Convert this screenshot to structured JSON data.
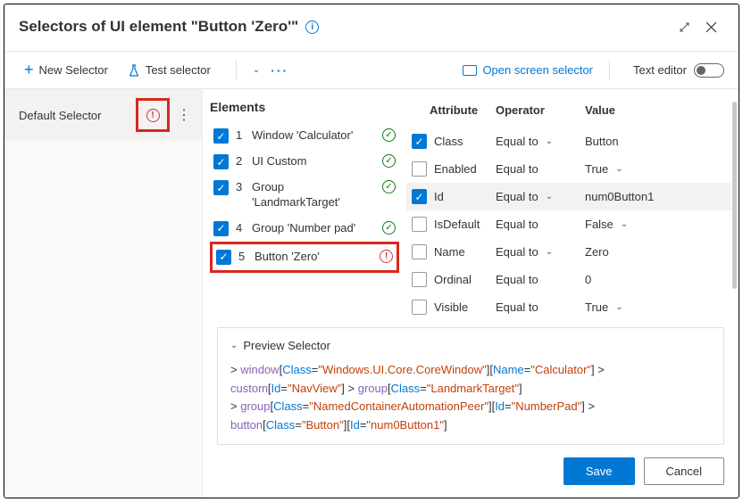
{
  "title": "Selectors of UI element \"Button 'Zero'\"",
  "toolbar": {
    "new_selector": "New Selector",
    "test_selector": "Test selector",
    "open_screen": "Open screen selector",
    "text_editor": "Text editor"
  },
  "sidebar": {
    "default_selector": "Default Selector"
  },
  "elements": {
    "heading": "Elements",
    "rows": [
      {
        "n": "1",
        "label": "Window 'Calculator'",
        "ok": true
      },
      {
        "n": "2",
        "label": "UI Custom",
        "ok": true
      },
      {
        "n": "3",
        "label": "Group 'LandmarkTarget'",
        "ok": true
      },
      {
        "n": "4",
        "label": "Group 'Number pad'",
        "ok": true
      },
      {
        "n": "5",
        "label": "Button 'Zero'",
        "ok": false
      }
    ]
  },
  "attr": {
    "h1": "Attribute",
    "h2": "Operator",
    "h3": "Value",
    "rows": [
      {
        "name": "Class",
        "op": "Equal to",
        "val": "Button",
        "cb": true,
        "chev_op": true,
        "chev_val": false,
        "sel": false
      },
      {
        "name": "Enabled",
        "op": "Equal to",
        "val": "True",
        "cb": false,
        "chev_op": false,
        "chev_val": true,
        "sel": false
      },
      {
        "name": "Id",
        "op": "Equal to",
        "val": "num0Button1",
        "cb": true,
        "chev_op": true,
        "chev_val": false,
        "sel": true
      },
      {
        "name": "IsDefault",
        "op": "Equal to",
        "val": "False",
        "cb": false,
        "chev_op": false,
        "chev_val": true,
        "sel": false
      },
      {
        "name": "Name",
        "op": "Equal to",
        "val": "Zero",
        "cb": false,
        "chev_op": true,
        "chev_val": false,
        "sel": false
      },
      {
        "name": "Ordinal",
        "op": "Equal to",
        "val": "0",
        "cb": false,
        "chev_op": false,
        "chev_val": false,
        "sel": false
      },
      {
        "name": "Visible",
        "op": "Equal to",
        "val": "True",
        "cb": false,
        "chev_op": false,
        "chev_val": true,
        "sel": false
      }
    ]
  },
  "preview": {
    "title": "Preview Selector",
    "s1": {
      "t": "window",
      "a1": "Class",
      "v1": "Windows.UI.Core.CoreWindow",
      "a2": "Name",
      "v2": "Calculator"
    },
    "s2": {
      "t": "custom",
      "a1": "Id",
      "v1": "NavView"
    },
    "s3": {
      "t": "group",
      "a1": "Class",
      "v1": "LandmarkTarget"
    },
    "s4": {
      "t": "group",
      "a1": "Class",
      "v1": "NamedContainerAutomationPeer",
      "a2": "Id",
      "v2": "NumberPad"
    },
    "s5": {
      "t": "button",
      "a1": "Class",
      "v1": "Button",
      "a2": "Id",
      "v2": "num0Button1"
    }
  },
  "footer": {
    "save": "Save",
    "cancel": "Cancel"
  }
}
